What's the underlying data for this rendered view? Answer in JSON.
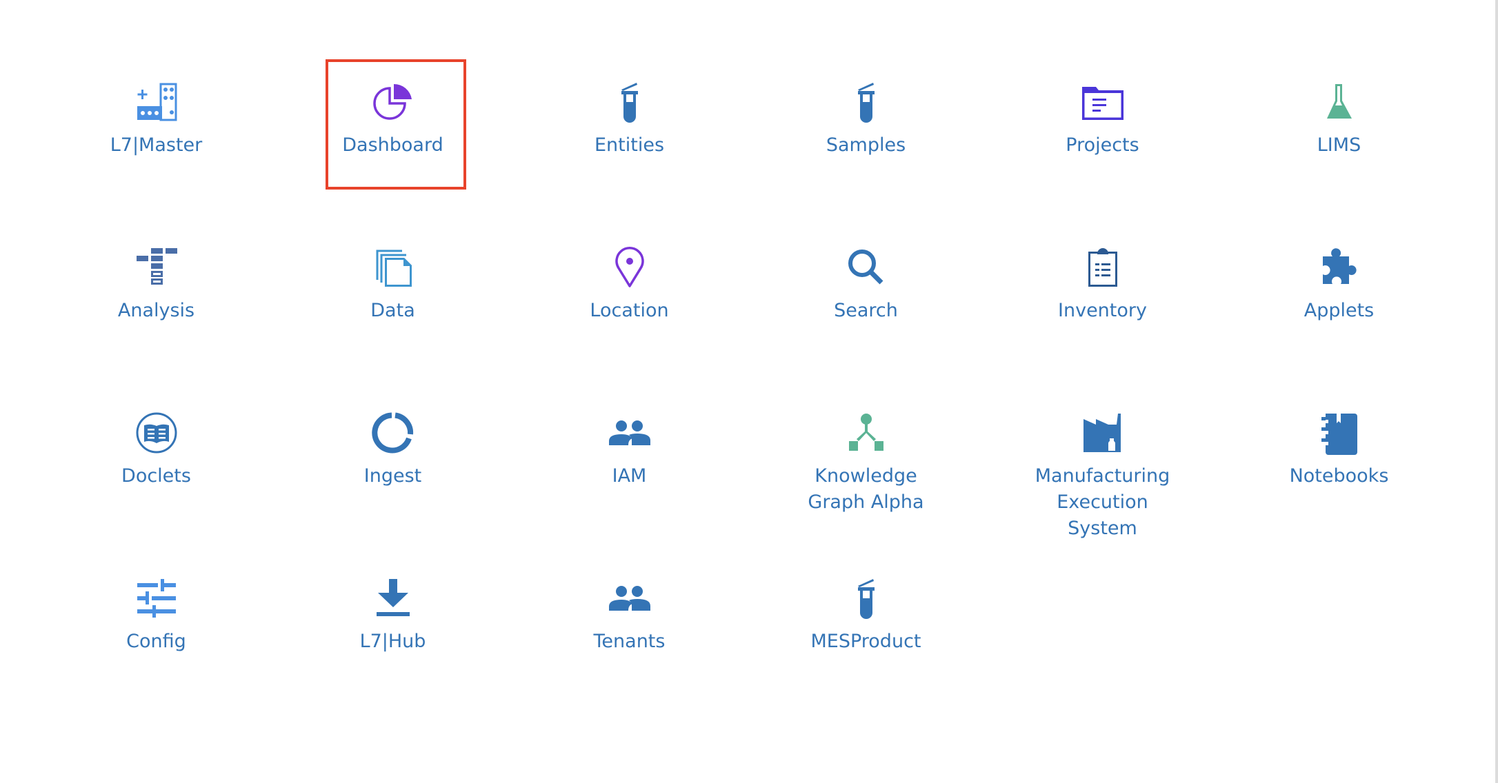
{
  "colors": {
    "label": "#3474b5",
    "icon_blue": "#3474b5",
    "icon_light_blue": "#4a90e2",
    "icon_sky": "#3e95cf",
    "icon_purple": "#7a35d9",
    "icon_indigo": "#4a35d9",
    "icon_green": "#5bb394",
    "icon_slate": "#4a6ea8",
    "highlight": "#e8432b"
  },
  "highlighted_app": "Dashboard",
  "apps": [
    {
      "label": "L7|Master",
      "icon": "building-grid-icon"
    },
    {
      "label": "Dashboard",
      "icon": "pie-chart-icon"
    },
    {
      "label": "Entities",
      "icon": "test-tube-icon"
    },
    {
      "label": "Samples",
      "icon": "test-tube-icon"
    },
    {
      "label": "Projects",
      "icon": "folder-list-icon"
    },
    {
      "label": "LIMS",
      "icon": "flask-icon"
    },
    {
      "label": "Analysis",
      "icon": "tree-blocks-icon"
    },
    {
      "label": "Data",
      "icon": "stacked-files-icon"
    },
    {
      "label": "Location",
      "icon": "map-pin-icon"
    },
    {
      "label": "Search",
      "icon": "magnifier-icon"
    },
    {
      "label": "Inventory",
      "icon": "clipboard-list-icon"
    },
    {
      "label": "Applets",
      "icon": "puzzle-piece-icon"
    },
    {
      "label": "Doclets",
      "icon": "book-circle-icon"
    },
    {
      "label": "Ingest",
      "icon": "ring-segment-icon"
    },
    {
      "label": "IAM",
      "icon": "users-icon"
    },
    {
      "label": "Knowledge Graph Alpha",
      "icon": "graph-nodes-icon"
    },
    {
      "label": "Manufacturing Execution System",
      "icon": "factory-icon"
    },
    {
      "label": "Notebooks",
      "icon": "notebook-icon"
    },
    {
      "label": "Config",
      "icon": "sliders-icon"
    },
    {
      "label": "L7|Hub",
      "icon": "download-icon"
    },
    {
      "label": "Tenants",
      "icon": "users-icon"
    },
    {
      "label": "MESProduct",
      "icon": "test-tube-icon"
    }
  ]
}
